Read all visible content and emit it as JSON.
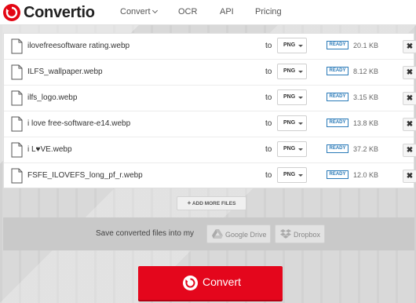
{
  "header": {
    "logo_text": "Convertio",
    "nav": [
      {
        "label": "Convert"
      },
      {
        "label": "OCR"
      },
      {
        "label": "API"
      },
      {
        "label": "Pricing"
      }
    ]
  },
  "files": [
    {
      "name": "ilovefreesoftware rating.webp",
      "to": "to",
      "format": "PNG",
      "status": "READY",
      "size": "20.1 KB",
      "remove": "✖"
    },
    {
      "name": "ILFS_wallpaper.webp",
      "to": "to",
      "format": "PNG",
      "status": "READY",
      "size": "8.12 KB",
      "remove": "✖"
    },
    {
      "name": "ilfs_logo.webp",
      "to": "to",
      "format": "PNG",
      "status": "READY",
      "size": "3.15 KB",
      "remove": "✖"
    },
    {
      "name": "i love free-software-e14.webp",
      "to": "to",
      "format": "PNG",
      "status": "READY",
      "size": "13.8 KB",
      "remove": "✖"
    },
    {
      "name": "i L♥VE.webp",
      "to": "to",
      "format": "PNG",
      "status": "READY",
      "size": "37.2 KB",
      "remove": "✖"
    },
    {
      "name": "FSFE_ILOVEFS_long_pf_r.webp",
      "to": "to",
      "format": "PNG",
      "status": "READY",
      "size": "12.0 KB",
      "remove": "✖"
    }
  ],
  "actions": {
    "add_more_label": "ADD MORE FILES",
    "save_label": "Save converted files into my",
    "google_drive_label": "Google Drive",
    "dropbox_label": "Dropbox",
    "convert_label": "Convert"
  },
  "colors": {
    "brand_red": "#e4061c",
    "ready_blue": "#2a7ab8"
  }
}
